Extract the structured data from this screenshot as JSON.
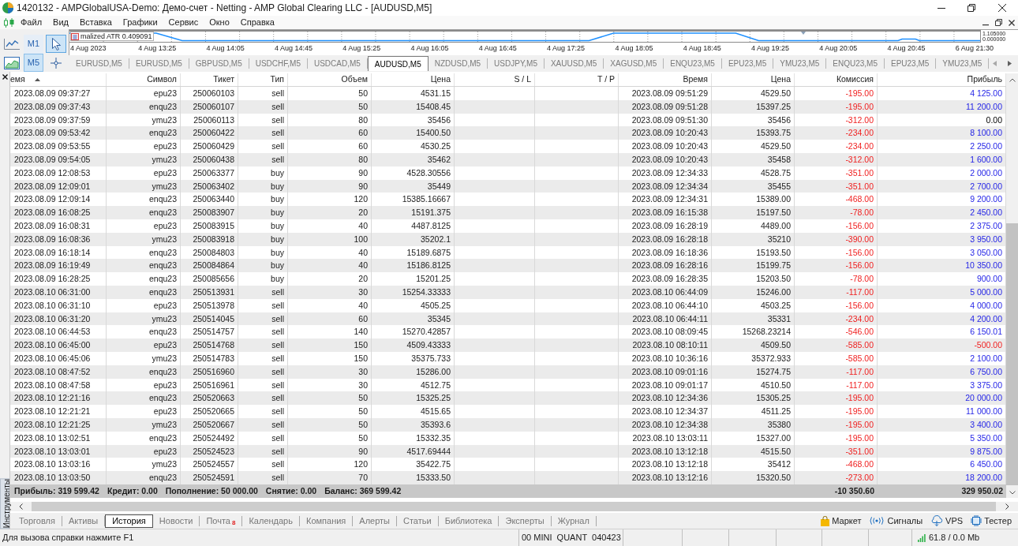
{
  "window": {
    "title": "1420132 - AMPGlobalUSA-Demo: Демо-счет - Netting - AMP Global Clearing LLC - [AUDUSD,M5]"
  },
  "menu": [
    "Файл",
    "Вид",
    "Вставка",
    "Графики",
    "Сервис",
    "Окно",
    "Справка"
  ],
  "toolbar": {
    "timeframes": [
      {
        "label": "M1",
        "selected": false
      },
      {
        "label": "M5",
        "selected": true
      }
    ],
    "tools": [
      {
        "kind": "cursor",
        "selected": true
      },
      {
        "kind": "crosshair",
        "selected": false
      }
    ]
  },
  "chart": {
    "indicator_label": "malized ATR 0.409091",
    "scale_labels": [
      "1.105000",
      "0.000000"
    ],
    "time_labels": [
      "4 Aug 2023",
      "4 Aug 13:25",
      "4 Aug 14:05",
      "4 Aug 14:45",
      "4 Aug 15:25",
      "4 Aug 16:05",
      "4 Aug 16:45",
      "4 Aug 17:25",
      "4 Aug 18:05",
      "4 Aug 18:45",
      "4 Aug 19:25",
      "4 Aug 20:05",
      "4 Aug 20:45",
      "6 Aug 21:30"
    ]
  },
  "chart_tabs": [
    {
      "label": "EURUSD,M5",
      "selected": false
    },
    {
      "label": "EURUSD,M5",
      "selected": false
    },
    {
      "label": "GBPUSD,M5",
      "selected": false
    },
    {
      "label": "USDCHF,M5",
      "selected": false
    },
    {
      "label": "USDCAD,M5",
      "selected": false
    },
    {
      "label": "AUDUSD,M5",
      "selected": true
    },
    {
      "label": "NZDUSD,M5",
      "selected": false
    },
    {
      "label": "USDJPY,M5",
      "selected": false
    },
    {
      "label": "XAUUSD,M5",
      "selected": false
    },
    {
      "label": "XAGUSD,M5",
      "selected": false
    },
    {
      "label": "ENQU23,M5",
      "selected": false
    },
    {
      "label": "EPU23,M5",
      "selected": false
    },
    {
      "label": "YMU23,M5",
      "selected": false
    },
    {
      "label": "ENQU23,M5",
      "selected": false
    },
    {
      "label": "EPU23,M5",
      "selected": false
    },
    {
      "label": "YMU23,M5",
      "selected": false
    }
  ],
  "toolbox": {
    "title": "Инструменты",
    "table": {
      "columns": [
        {
          "label": "емя",
          "sorted": true
        },
        {
          "label": "Символ",
          "sorted": false
        },
        {
          "label": "Тикет",
          "sorted": false
        },
        {
          "label": "Тип",
          "sorted": false
        },
        {
          "label": "Объем",
          "sorted": false
        },
        {
          "label": "Цена",
          "sorted": false
        },
        {
          "label": "S / L",
          "sorted": false
        },
        {
          "label": "T / P",
          "sorted": false
        },
        {
          "label": "Время",
          "sorted": false
        },
        {
          "label": "Цена",
          "sorted": false
        },
        {
          "label": "Комиссия",
          "sorted": false
        },
        {
          "label": "Прибыль",
          "sorted": false
        }
      ],
      "rows": [
        {
          "time": "2023.08.09 09:37:27",
          "symbol": "epu23",
          "ticket": "250060103",
          "type": "sell",
          "volume": "50",
          "price": "4531.15",
          "close_time": "2023.08.09 09:51:29",
          "close_price": "4529.50",
          "commission": "-195.00",
          "profit": {
            "text": "4 125.00",
            "kind": "gain"
          }
        },
        {
          "time": "2023.08.09 09:37:43",
          "symbol": "enqu23",
          "ticket": "250060107",
          "type": "sell",
          "volume": "50",
          "price": "15408.45",
          "close_time": "2023.08.09 09:51:28",
          "close_price": "15397.25",
          "commission": "-195.00",
          "profit": {
            "text": "11 200.00",
            "kind": "gain"
          }
        },
        {
          "time": "2023.08.09 09:37:59",
          "symbol": "ymu23",
          "ticket": "250060113",
          "type": "sell",
          "volume": "80",
          "price": "35456",
          "close_time": "2023.08.09 09:51:30",
          "close_price": "35456",
          "commission": "-312.00",
          "profit": {
            "text": "0.00",
            "kind": "zero"
          }
        },
        {
          "time": "2023.08.09 09:53:42",
          "symbol": "enqu23",
          "ticket": "250060422",
          "type": "sell",
          "volume": "60",
          "price": "15400.50",
          "close_time": "2023.08.09 10:20:43",
          "close_price": "15393.75",
          "commission": "-234.00",
          "profit": {
            "text": "8 100.00",
            "kind": "gain"
          }
        },
        {
          "time": "2023.08.09 09:53:55",
          "symbol": "epu23",
          "ticket": "250060429",
          "type": "sell",
          "volume": "60",
          "price": "4530.25",
          "close_time": "2023.08.09 10:20:43",
          "close_price": "4529.50",
          "commission": "-234.00",
          "profit": {
            "text": "2 250.00",
            "kind": "gain"
          }
        },
        {
          "time": "2023.08.09 09:54:05",
          "symbol": "ymu23",
          "ticket": "250060438",
          "type": "sell",
          "volume": "80",
          "price": "35462",
          "close_time": "2023.08.09 10:20:43",
          "close_price": "35458",
          "commission": "-312.00",
          "profit": {
            "text": "1 600.00",
            "kind": "gain"
          }
        },
        {
          "time": "2023.08.09 12:08:53",
          "symbol": "epu23",
          "ticket": "250063377",
          "type": "buy",
          "volume": "90",
          "price": "4528.30556",
          "close_time": "2023.08.09 12:34:33",
          "close_price": "4528.75",
          "commission": "-351.00",
          "profit": {
            "text": "2 000.00",
            "kind": "gain"
          }
        },
        {
          "time": "2023.08.09 12:09:01",
          "symbol": "ymu23",
          "ticket": "250063402",
          "type": "buy",
          "volume": "90",
          "price": "35449",
          "close_time": "2023.08.09 12:34:34",
          "close_price": "35455",
          "commission": "-351.00",
          "profit": {
            "text": "2 700.00",
            "kind": "gain"
          }
        },
        {
          "time": "2023.08.09 12:09:14",
          "symbol": "enqu23",
          "ticket": "250063440",
          "type": "buy",
          "volume": "120",
          "price": "15385.16667",
          "close_time": "2023.08.09 12:34:31",
          "close_price": "15389.00",
          "commission": "-468.00",
          "profit": {
            "text": "9 200.00",
            "kind": "gain"
          }
        },
        {
          "time": "2023.08.09 16:08:25",
          "symbol": "enqu23",
          "ticket": "250083907",
          "type": "buy",
          "volume": "20",
          "price": "15191.375",
          "close_time": "2023.08.09 16:15:38",
          "close_price": "15197.50",
          "commission": "-78.00",
          "profit": {
            "text": "2 450.00",
            "kind": "gain"
          }
        },
        {
          "time": "2023.08.09 16:08:31",
          "symbol": "epu23",
          "ticket": "250083915",
          "type": "buy",
          "volume": "40",
          "price": "4487.8125",
          "close_time": "2023.08.09 16:28:19",
          "close_price": "4489.00",
          "commission": "-156.00",
          "profit": {
            "text": "2 375.00",
            "kind": "gain"
          }
        },
        {
          "time": "2023.08.09 16:08:36",
          "symbol": "ymu23",
          "ticket": "250083918",
          "type": "buy",
          "volume": "100",
          "price": "35202.1",
          "close_time": "2023.08.09 16:28:18",
          "close_price": "35210",
          "commission": "-390.00",
          "profit": {
            "text": "3 950.00",
            "kind": "gain"
          }
        },
        {
          "time": "2023.08.09 16:18:14",
          "symbol": "enqu23",
          "ticket": "250084803",
          "type": "buy",
          "volume": "40",
          "price": "15189.6875",
          "close_time": "2023.08.09 16:18:36",
          "close_price": "15193.50",
          "commission": "-156.00",
          "profit": {
            "text": "3 050.00",
            "kind": "gain"
          }
        },
        {
          "time": "2023.08.09 16:19:49",
          "symbol": "enqu23",
          "ticket": "250084864",
          "type": "buy",
          "volume": "40",
          "price": "15186.8125",
          "close_time": "2023.08.09 16:28:16",
          "close_price": "15199.75",
          "commission": "-156.00",
          "profit": {
            "text": "10 350.00",
            "kind": "gain"
          }
        },
        {
          "time": "2023.08.09 16:28:25",
          "symbol": "enqu23",
          "ticket": "250085656",
          "type": "buy",
          "volume": "20",
          "price": "15201.25",
          "close_time": "2023.08.09 16:28:35",
          "close_price": "15203.50",
          "commission": "-78.00",
          "profit": {
            "text": "900.00",
            "kind": "gain"
          }
        },
        {
          "time": "2023.08.10 06:31:00",
          "symbol": "enqu23",
          "ticket": "250513931",
          "type": "sell",
          "volume": "30",
          "price": "15254.33333",
          "close_time": "2023.08.10 06:44:09",
          "close_price": "15246.00",
          "commission": "-117.00",
          "profit": {
            "text": "5 000.00",
            "kind": "gain"
          }
        },
        {
          "time": "2023.08.10 06:31:10",
          "symbol": "epu23",
          "ticket": "250513978",
          "type": "sell",
          "volume": "40",
          "price": "4505.25",
          "close_time": "2023.08.10 06:44:10",
          "close_price": "4503.25",
          "commission": "-156.00",
          "profit": {
            "text": "4 000.00",
            "kind": "gain"
          }
        },
        {
          "time": "2023.08.10 06:31:20",
          "symbol": "ymu23",
          "ticket": "250514045",
          "type": "sell",
          "volume": "60",
          "price": "35345",
          "close_time": "2023.08.10 06:44:11",
          "close_price": "35331",
          "commission": "-234.00",
          "profit": {
            "text": "4 200.00",
            "kind": "gain"
          }
        },
        {
          "time": "2023.08.10 06:44:53",
          "symbol": "enqu23",
          "ticket": "250514757",
          "type": "sell",
          "volume": "140",
          "price": "15270.42857",
          "close_time": "2023.08.10 08:09:45",
          "close_price": "15268.23214",
          "commission": "-546.00",
          "profit": {
            "text": "6 150.01",
            "kind": "gain"
          }
        },
        {
          "time": "2023.08.10 06:45:00",
          "symbol": "epu23",
          "ticket": "250514768",
          "type": "sell",
          "volume": "150",
          "price": "4509.43333",
          "close_time": "2023.08.10 08:10:11",
          "close_price": "4509.50",
          "commission": "-585.00",
          "profit": {
            "text": "-500.00",
            "kind": "loss"
          }
        },
        {
          "time": "2023.08.10 06:45:06",
          "symbol": "ymu23",
          "ticket": "250514783",
          "type": "sell",
          "volume": "150",
          "price": "35375.733",
          "close_time": "2023.08.10 10:36:16",
          "close_price": "35372.933",
          "commission": "-585.00",
          "profit": {
            "text": "2 100.00",
            "kind": "gain"
          }
        },
        {
          "time": "2023.08.10 08:47:52",
          "symbol": "enqu23",
          "ticket": "250516960",
          "type": "sell",
          "volume": "30",
          "price": "15286.00",
          "close_time": "2023.08.10 09:01:16",
          "close_price": "15274.75",
          "commission": "-117.00",
          "profit": {
            "text": "6 750.00",
            "kind": "gain"
          }
        },
        {
          "time": "2023.08.10 08:47:58",
          "symbol": "epu23",
          "ticket": "250516961",
          "type": "sell",
          "volume": "30",
          "price": "4512.75",
          "close_time": "2023.08.10 09:01:17",
          "close_price": "4510.50",
          "commission": "-117.00",
          "profit": {
            "text": "3 375.00",
            "kind": "gain"
          }
        },
        {
          "time": "2023.08.10 12:21:16",
          "symbol": "enqu23",
          "ticket": "250520663",
          "type": "sell",
          "volume": "50",
          "price": "15325.25",
          "close_time": "2023.08.10 12:34:36",
          "close_price": "15305.25",
          "commission": "-195.00",
          "profit": {
            "text": "20 000.00",
            "kind": "gain"
          }
        },
        {
          "time": "2023.08.10 12:21:21",
          "symbol": "epu23",
          "ticket": "250520665",
          "type": "sell",
          "volume": "50",
          "price": "4515.65",
          "close_time": "2023.08.10 12:34:37",
          "close_price": "4511.25",
          "commission": "-195.00",
          "profit": {
            "text": "11 000.00",
            "kind": "gain"
          }
        },
        {
          "time": "2023.08.10 12:21:25",
          "symbol": "ymu23",
          "ticket": "250520667",
          "type": "sell",
          "volume": "50",
          "price": "35393.6",
          "close_time": "2023.08.10 12:34:38",
          "close_price": "35380",
          "commission": "-195.00",
          "profit": {
            "text": "3 400.00",
            "kind": "gain"
          }
        },
        {
          "time": "2023.08.10 13:02:51",
          "symbol": "enqu23",
          "ticket": "250524492",
          "type": "sell",
          "volume": "50",
          "price": "15332.35",
          "close_time": "2023.08.10 13:03:11",
          "close_price": "15327.00",
          "commission": "-195.00",
          "profit": {
            "text": "5 350.00",
            "kind": "gain"
          }
        },
        {
          "time": "2023.08.10 13:03:01",
          "symbol": "epu23",
          "ticket": "250524523",
          "type": "sell",
          "volume": "90",
          "price": "4517.69444",
          "close_time": "2023.08.10 13:12:18",
          "close_price": "4515.50",
          "commission": "-351.00",
          "profit": {
            "text": "9 875.00",
            "kind": "gain"
          }
        },
        {
          "time": "2023.08.10 13:03:16",
          "symbol": "ymu23",
          "ticket": "250524557",
          "type": "sell",
          "volume": "120",
          "price": "35422.75",
          "close_time": "2023.08.10 13:12:18",
          "close_price": "35412",
          "commission": "-468.00",
          "profit": {
            "text": "6 450.00",
            "kind": "gain"
          }
        },
        {
          "time": "2023.08.10 13:03:50",
          "symbol": "enqu23",
          "ticket": "250524591",
          "type": "sell",
          "volume": "70",
          "price": "15333.50",
          "close_time": "2023.08.10 13:12:16",
          "close_price": "15320.50",
          "commission": "-273.00",
          "profit": {
            "text": "18 200.00",
            "kind": "gain"
          }
        }
      ],
      "summary": {
        "items": [
          "Прибыль: 319 599.42",
          "Кредит: 0.00",
          "Пополнение: 50 000.00",
          "Снятие: 0.00",
          "Баланс: 369 599.42"
        ],
        "commission": "-10 350.60",
        "profit": "329 950.02"
      }
    },
    "tabs": [
      {
        "label": "Торговля",
        "selected": false
      },
      {
        "label": "Активы",
        "selected": false
      },
      {
        "label": "История",
        "selected": true
      },
      {
        "label": "Новости",
        "selected": false
      },
      {
        "label": "Почта",
        "selected": false,
        "badge": "8"
      },
      {
        "label": "Календарь",
        "selected": false
      },
      {
        "label": "Компания",
        "selected": false
      },
      {
        "label": "Алерты",
        "selected": false
      },
      {
        "label": "Статьи",
        "selected": false
      },
      {
        "label": "Библиотека",
        "selected": false
      },
      {
        "label": "Эксперты",
        "selected": false
      },
      {
        "label": "Журнал",
        "selected": false
      }
    ],
    "services": [
      {
        "kind": "market",
        "label": "Маркет"
      },
      {
        "kind": "signals",
        "label": "Сигналы"
      },
      {
        "kind": "vps",
        "label": "VPS"
      },
      {
        "kind": "tester",
        "label": "Тестер"
      }
    ]
  },
  "status_bar": {
    "help": "Для вызова справки нажмите F1",
    "profile": "00 MINI  QUANT  040423",
    "traffic": "61.8 / 0.0 Mb"
  }
}
